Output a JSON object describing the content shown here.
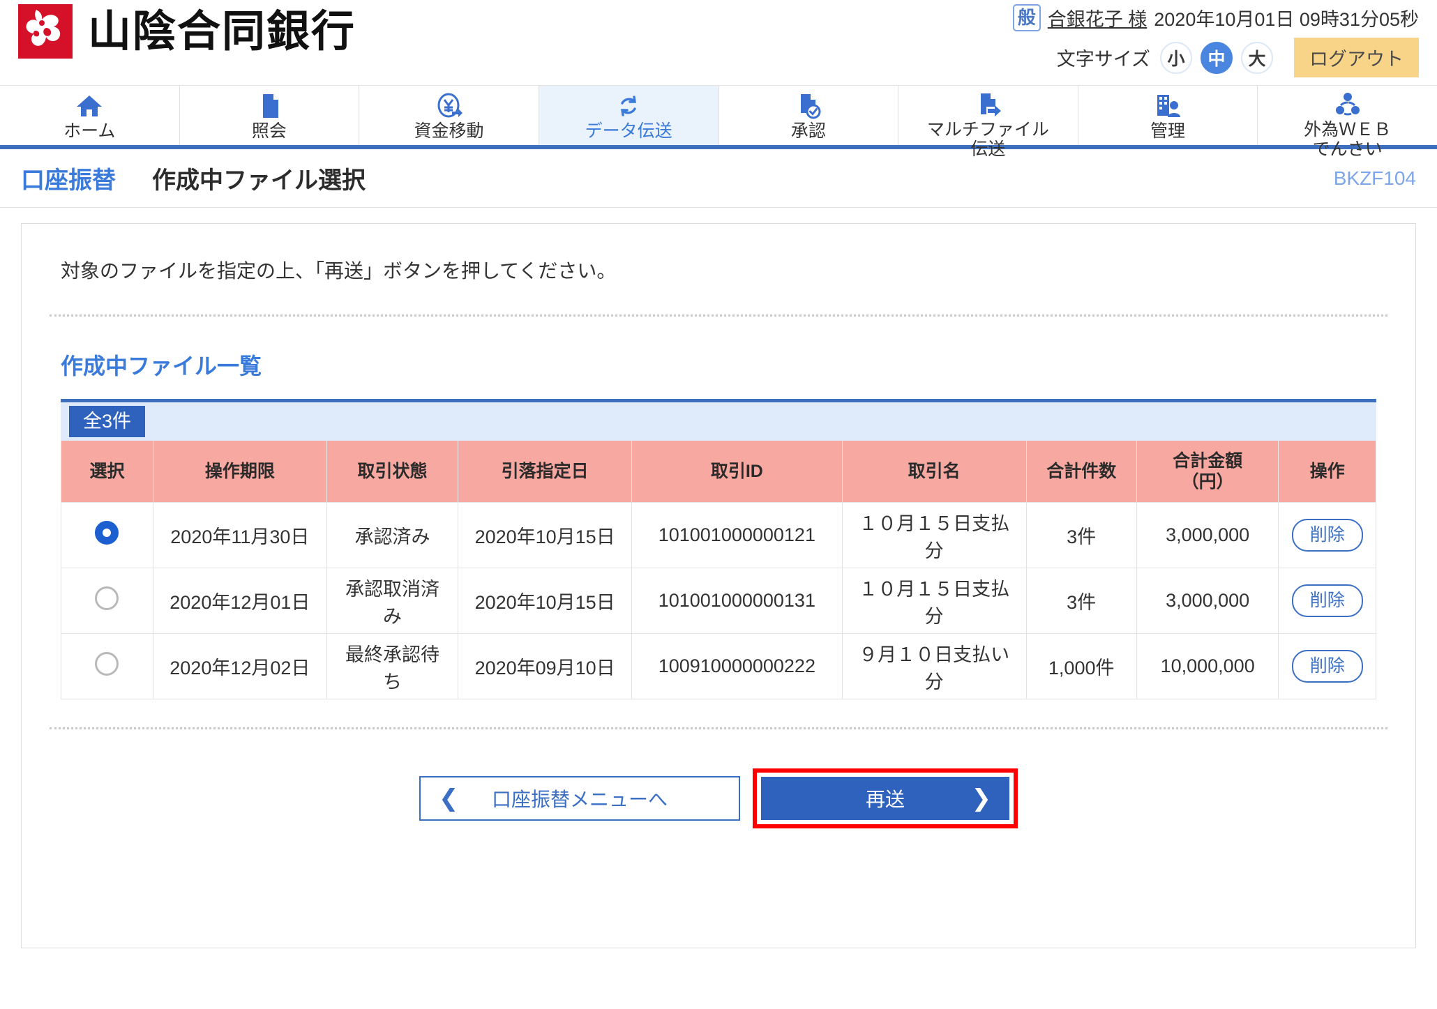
{
  "header": {
    "bank_name": "山陰合同銀行",
    "logo_icon": "sanin-godo-bank-logo",
    "user_badge": "般",
    "user_name": "合銀花子 様",
    "datetime": "2020年10月01日 09時31分05秒",
    "font_size_label": "文字サイズ",
    "font_sizes": [
      {
        "label": "小",
        "active": false
      },
      {
        "label": "中",
        "active": true
      },
      {
        "label": "大",
        "active": false
      }
    ],
    "logout_label": "ログアウト"
  },
  "nav": {
    "items": [
      {
        "label": "ホーム",
        "icon": "home-icon",
        "active": false
      },
      {
        "label": "照会",
        "icon": "document-icon",
        "active": false
      },
      {
        "label": "資金移動",
        "icon": "yen-transfer-icon",
        "active": false
      },
      {
        "label": "データ伝送",
        "icon": "sync-arrows-icon",
        "active": true
      },
      {
        "label": "承認",
        "icon": "document-check-icon",
        "active": false
      },
      {
        "label": "マルチファイル\n伝送",
        "icon": "file-send-icon",
        "active": false
      },
      {
        "label": "管理",
        "icon": "building-user-icon",
        "active": false
      },
      {
        "label": "外為ＷＥＢ\nでんさい",
        "icon": "network-share-icon",
        "active": false
      }
    ]
  },
  "page": {
    "category": "口座振替",
    "title": "作成中ファイル選択",
    "code": "BKZF104",
    "instruction": "対象のファイルを指定の上、「再送」ボタンを押してください。",
    "section_title": "作成中ファイル一覧"
  },
  "table": {
    "count_badge": "全3件",
    "columns": [
      "選択",
      "操作期限",
      "取引状態",
      "引落指定日",
      "取引ID",
      "取引名",
      "合計件数",
      "合計金額\n（円）",
      "操作"
    ],
    "column_amount_line1": "合計金額",
    "column_amount_line2": "（円）",
    "delete_label": "削除",
    "rows": [
      {
        "selected": true,
        "deadline": "2020年11月30日",
        "status": "承認済み",
        "draw_date": "2020年10月15日",
        "transaction_id": "101001000000121",
        "transaction_name": "１０月１５日支払分",
        "total_count": "3件",
        "total_amount": "3,000,000",
        "action": "削除"
      },
      {
        "selected": false,
        "deadline": "2020年12月01日",
        "status": "承認取消済み",
        "draw_date": "2020年10月15日",
        "transaction_id": "101001000000131",
        "transaction_name": "１０月１５日支払分",
        "total_count": "3件",
        "total_amount": "3,000,000",
        "action": "削除"
      },
      {
        "selected": false,
        "deadline": "2020年12月02日",
        "status": "最終承認待ち",
        "draw_date": "2020年09月10日",
        "transaction_id": "100910000000222",
        "transaction_name": "９月１０日支払い分",
        "total_count": "1,000件",
        "total_amount": "10,000,000",
        "action": "削除"
      }
    ]
  },
  "actions": {
    "back_label": "口座振替メニューへ",
    "back_chevron": "❮",
    "submit_label": "再送",
    "submit_chevron": "❯"
  },
  "colors": {
    "brand_red": "#d5112a",
    "primary_blue": "#2f62bd",
    "nav_active_blue": "#3a7ada",
    "table_header_pink": "#f7a8a0",
    "logout_amber": "#f8d488",
    "highlight_red": "#ff0000"
  }
}
